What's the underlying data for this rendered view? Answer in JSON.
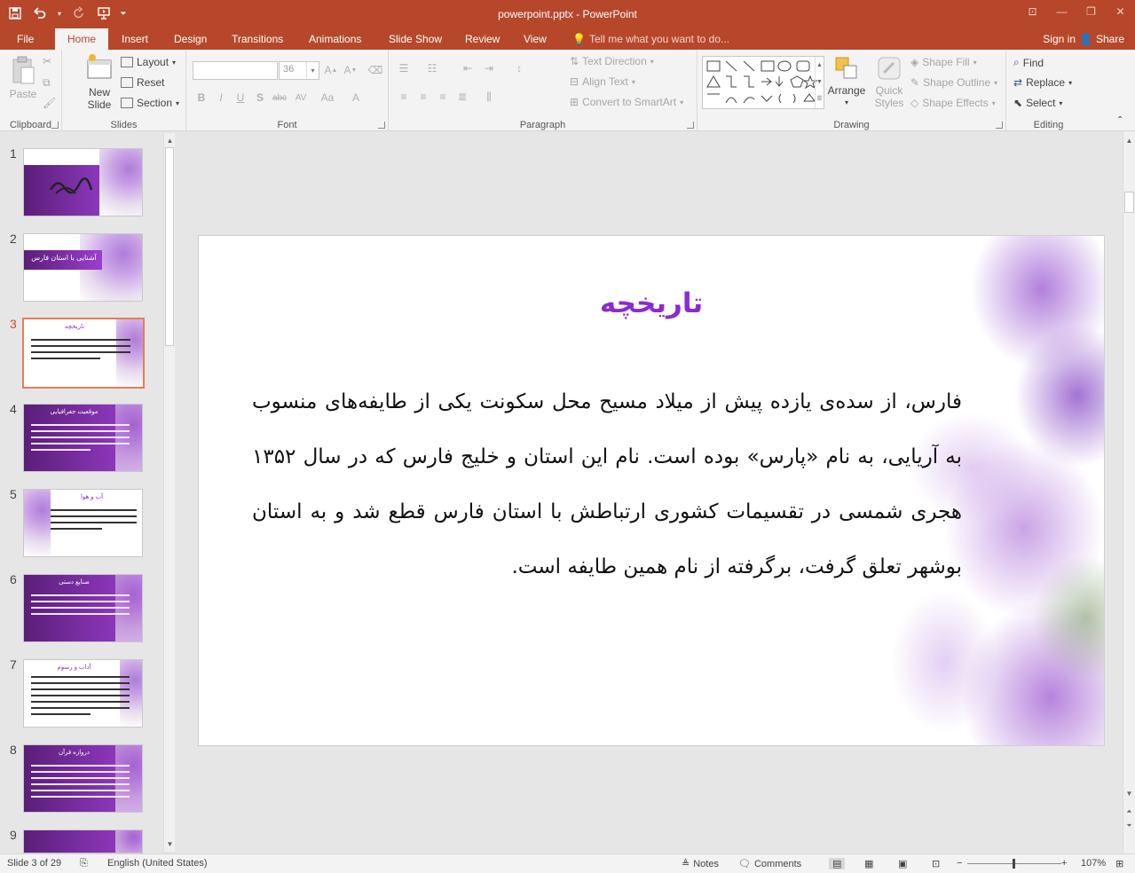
{
  "window": {
    "title": "powerpoint.pptx - PowerPoint"
  },
  "tabs": {
    "file": "File",
    "home": "Home",
    "insert": "Insert",
    "design": "Design",
    "transitions": "Transitions",
    "animations": "Animations",
    "slide_show": "Slide Show",
    "review": "Review",
    "view": "View",
    "tell_me": "Tell me what you want to do...",
    "sign_in": "Sign in",
    "share": "Share"
  },
  "ribbon": {
    "clipboard": {
      "label": "Clipboard",
      "paste": "Paste"
    },
    "slides": {
      "label": "Slides",
      "new_slide_1": "New",
      "new_slide_2": "Slide",
      "layout": "Layout",
      "reset": "Reset",
      "section": "Section"
    },
    "font": {
      "label": "Font",
      "font_name": "",
      "font_size": "36"
    },
    "paragraph": {
      "label": "Paragraph",
      "text_direction": "Text Direction",
      "align_text": "Align Text",
      "convert_smartart": "Convert to SmartArt"
    },
    "drawing": {
      "label": "Drawing",
      "arrange": "Arrange",
      "quick_styles_1": "Quick",
      "quick_styles_2": "Styles",
      "shape_fill": "Shape Fill",
      "shape_outline": "Shape Outline",
      "shape_effects": "Shape Effects"
    },
    "editing": {
      "label": "Editing",
      "find": "Find",
      "replace": "Replace",
      "select": "Select"
    }
  },
  "thumbnails": {
    "n1": "1",
    "n2": "2",
    "n3": "3",
    "n4": "4",
    "n5": "5",
    "n6": "6",
    "n7": "7",
    "n8": "8",
    "n9": "9",
    "t2_title": "آشنایی با استان فارس",
    "t3_title": "تاریخچه",
    "t4_title": "موقعیت جغرافیایی",
    "t5_title": "آب و هوا",
    "t6_title": "صنایع دستی",
    "t7_title": "آداب و رسوم",
    "t8_title": "دروازه قرآن"
  },
  "slide": {
    "title": "تاریخچه",
    "body": "فارس، از سده‌ی یازده پیش از میلاد مسیح محل سکونت یکی از طایفه‌های منسوب به آریایی، به نام «پارس» بوده است. نام این استان و خلیج فارس که در سال ۱۳۵۲ هجری شمسی در تقسیمات کشوری ارتباطش با استان فارس قطع شد و به استان بوشهر تعلق گرفت، برگرفته از نام همین طایفه است."
  },
  "status": {
    "slide_of": "Slide 3 of 29",
    "language": "English (United States)",
    "notes": "Notes",
    "comments": "Comments",
    "zoom": "107%"
  },
  "colors": {
    "accent": "#b7472a",
    "title_purple": "#8a2bd0",
    "selected_thumb_border": "#e97c56"
  }
}
